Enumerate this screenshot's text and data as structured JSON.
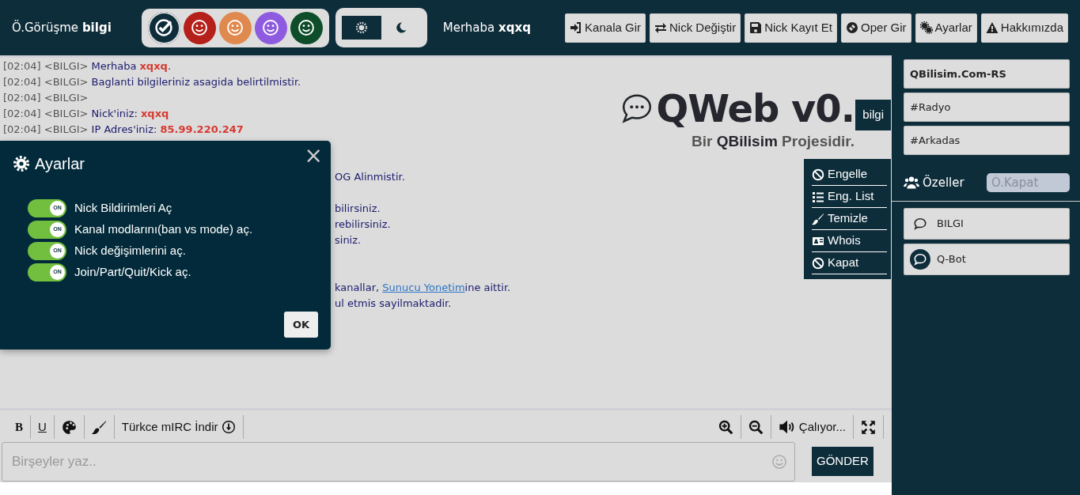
{
  "header": {
    "title": "Ö.Görüşme **bilgi**",
    "colors": [
      {
        "kind": "check",
        "color": "#0e2d3a",
        "selected": true
      },
      {
        "kind": "smile",
        "color": "#b5201b",
        "selected": false
      },
      {
        "kind": "smile",
        "color": "#e0894f",
        "selected": false
      },
      {
        "kind": "smile",
        "color": "#8e5be0",
        "selected": false
      },
      {
        "kind": "smile",
        "color": "#0e4d2a",
        "selected": false
      }
    ],
    "themes": [
      {
        "kind": "light",
        "selected": true
      },
      {
        "kind": "dark",
        "selected": false
      }
    ],
    "greeting": "Merhaba **xqxq**",
    "buttons": [
      {
        "kind": "join",
        "label": "Kanala Gir"
      },
      {
        "kind": "swap",
        "label": "Nick Değiştir"
      },
      {
        "kind": "save",
        "label": "Nick Kayıt Et"
      },
      {
        "kind": "oper",
        "label": "Oper Gir"
      },
      {
        "kind": "gears",
        "label": "Ayarlar"
      },
      {
        "kind": "warning",
        "label": "Hakkımızda"
      }
    ]
  },
  "chat": {
    "messages": [
      {
        "time": "[02:04]",
        "nick": "<BILGI>",
        "text": "Merhaba ",
        "highlight": "xqxq",
        "suffix": "."
      },
      {
        "time": "[02:04]",
        "nick": "<BILGI>",
        "text": "Baglanti bilgileriniz asagida belirtilmistir."
      },
      {
        "time": "[02:04]",
        "nick": "<BILGI>"
      },
      {
        "time": "[02:04]",
        "nick": "<BILGI>",
        "text": "Nick'iniz: ",
        "highlight": "xqxq"
      },
      {
        "time": "[02:04]",
        "nick": "<BILGI>",
        "text": "IP Adres'iniz: ",
        "highlight": "85.99.220.247"
      }
    ],
    "fragments": [
      {
        "text": "OG Alinmistir."
      },
      {
        "text": "bilirsiniz."
      },
      {
        "text": "rebilirsiniz."
      },
      {
        "text": "siniz."
      },
      {
        "text": "kanallar, ",
        "link": "Sunucu Yonetim",
        "suffix": "ine aittir."
      },
      {
        "text": "ul etmis sayilmaktadir."
      }
    ]
  },
  "logo": {
    "title": "QWeb v0.",
    "subtitle_pre": "Bir",
    "subtitle_brand": "QBilisim",
    "subtitle_post": "Projesidir."
  },
  "tab": {
    "label": "bilgi"
  },
  "context_menu": [
    {
      "kind": "ban",
      "label": "Engelle"
    },
    {
      "kind": "list",
      "label": "Eng. List"
    },
    {
      "kind": "brush",
      "label": "Temizle"
    },
    {
      "kind": "card",
      "label": "Whois"
    },
    {
      "kind": "ban",
      "label": "Kapat"
    }
  ],
  "settings_dialog": {
    "title": "Ayarlar",
    "close": "×",
    "options": [
      {
        "label": "Nick Bildirimleri Aç",
        "on": true,
        "switch_text": "ON"
      },
      {
        "label": "Kanal modlarını(ban vs mode) aç.",
        "on": true,
        "switch_text": "ON"
      },
      {
        "label": "Nick değişimlerini aç.",
        "on": true,
        "switch_text": "ON"
      },
      {
        "label": "Join/Part/Quit/Kick aç.",
        "on": true,
        "switch_text": "ON"
      }
    ],
    "ok": "OK"
  },
  "format_bar": {
    "left": [
      {
        "kind": "bold",
        "label": "B"
      },
      {
        "kind": "underline",
        "label": "U"
      },
      {
        "kind": "palette"
      },
      {
        "kind": "brush"
      },
      {
        "kind": "download",
        "label": "Türkce mIRC İndir"
      }
    ],
    "right": [
      {
        "kind": "zoom-in"
      },
      {
        "kind": "zoom-out"
      },
      {
        "kind": "sound",
        "label": "Çalıyor..."
      },
      {
        "kind": "fullscreen"
      }
    ]
  },
  "message_input": {
    "placeholder": "Birşeyler yaz..",
    "send": "GÖNDER"
  },
  "sidebar": {
    "channels": [
      {
        "label": "QBilisim.Com-RS",
        "selected": true
      },
      {
        "label": "#Radyo",
        "selected": false
      },
      {
        "label": "#Arkadas",
        "selected": false
      }
    ],
    "privates_title": "Özeller",
    "close_field": {
      "placeholder": "Ö.Kapat"
    },
    "privates": [
      {
        "label": "BILGI",
        "selected": false
      },
      {
        "label": "Q-Bot",
        "selected": true
      }
    ]
  }
}
